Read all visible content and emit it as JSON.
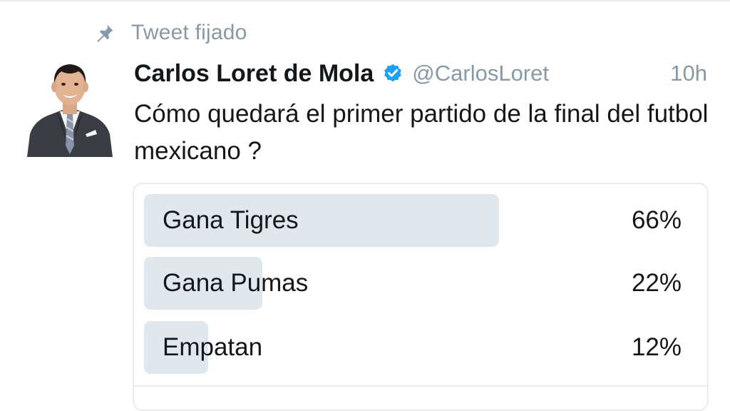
{
  "pinned": {
    "label": "Tweet fijado",
    "icon": "pin-icon"
  },
  "author": {
    "name": "Carlos Loret de Mola",
    "handle": "@CarlosLoret",
    "verified_icon": "verified-badge-icon",
    "verified_color": "#1da1f2"
  },
  "tweet": {
    "time": "10h",
    "text": "Cómo quedará el primer partido de la final del futbol mexicano ?"
  },
  "poll": {
    "bar_color": "#e1e8ed",
    "choices": [
      {
        "label": "Gana Tigres",
        "percent_label": "66%",
        "percent": 66
      },
      {
        "label": "Gana Pumas",
        "percent_label": "22%",
        "percent": 22
      },
      {
        "label": "Empatan",
        "percent_label": "12%",
        "percent": 12
      }
    ]
  }
}
